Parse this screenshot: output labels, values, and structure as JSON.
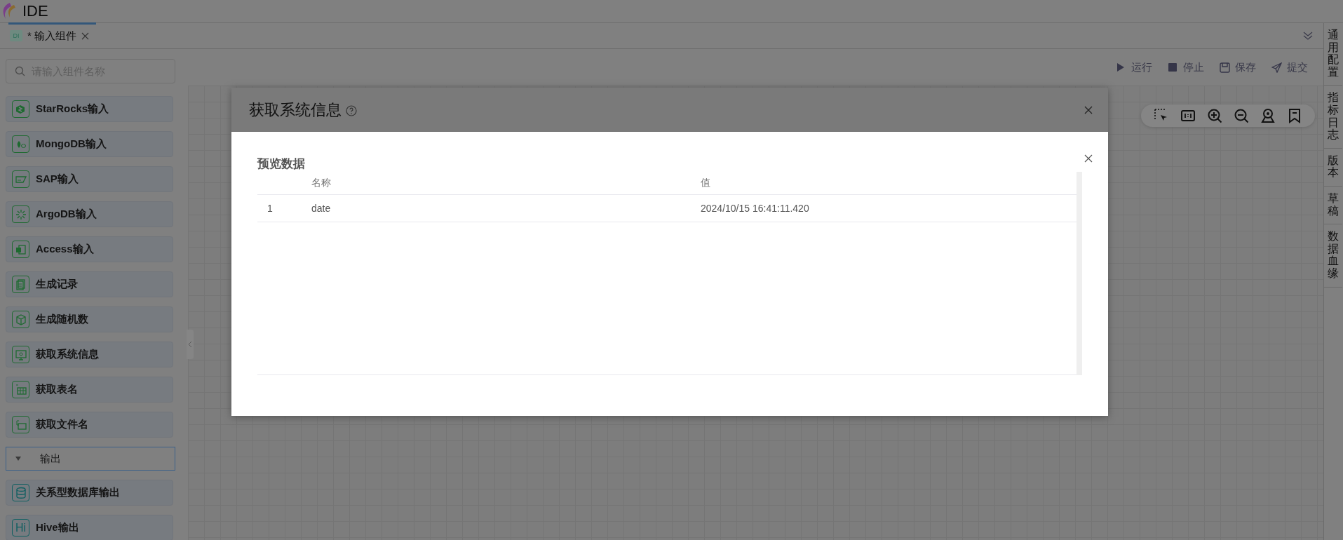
{
  "app": {
    "title": "IDE"
  },
  "tabs": [
    {
      "badge": "DI",
      "label": "* 输入组件",
      "selected": true
    }
  ],
  "search": {
    "placeholder": "请输入组件名称"
  },
  "actions": [
    {
      "kind": "run",
      "label": "运行"
    },
    {
      "kind": "stop",
      "label": "停止"
    },
    {
      "kind": "save",
      "label": "保存"
    },
    {
      "kind": "submit",
      "label": "提交"
    }
  ],
  "sidebar": {
    "items": [
      {
        "kind": "component",
        "label": "StarRocks输入",
        "color": "#1e6a30"
      },
      {
        "kind": "component",
        "label": "MongoDB输入",
        "color": "#1e6a30"
      },
      {
        "kind": "component",
        "label": "SAP输入",
        "color": "#1e6a30"
      },
      {
        "kind": "component",
        "label": "ArgoDB输入",
        "color": "#1e6a30"
      },
      {
        "kind": "component",
        "label": "Access输入",
        "color": "#1e6a30"
      },
      {
        "kind": "component",
        "label": "生成记录",
        "color": "#1e6a30"
      },
      {
        "kind": "component",
        "label": "生成随机数",
        "color": "#1e6a30"
      },
      {
        "kind": "component",
        "label": "获取系统信息",
        "color": "#1e6a30"
      },
      {
        "kind": "component",
        "label": "获取表名",
        "color": "#1e6a30"
      },
      {
        "kind": "component",
        "label": "获取文件名",
        "color": "#1e6a30"
      },
      {
        "kind": "group",
        "label": "输出",
        "expanded": true
      },
      {
        "kind": "component",
        "label": "关系型数据库输出",
        "color": "#0f5f60"
      },
      {
        "kind": "component",
        "label": "Hive输出",
        "color": "#0f5f60",
        "badge": "Hi"
      }
    ]
  },
  "right_panel": [
    {
      "label": "通用配置"
    },
    {
      "label": "指标日志"
    },
    {
      "label": "版本"
    },
    {
      "label": "草稿"
    },
    {
      "label": "数据血缘"
    }
  ],
  "dialog": {
    "title": "获取系统信息",
    "preview": {
      "title": "预览数据",
      "columns": [
        "名称",
        "值"
      ],
      "rows": [
        {
          "index": "1",
          "cells": [
            "date",
            "2024/10/15 16:41:11.420"
          ]
        }
      ]
    }
  }
}
